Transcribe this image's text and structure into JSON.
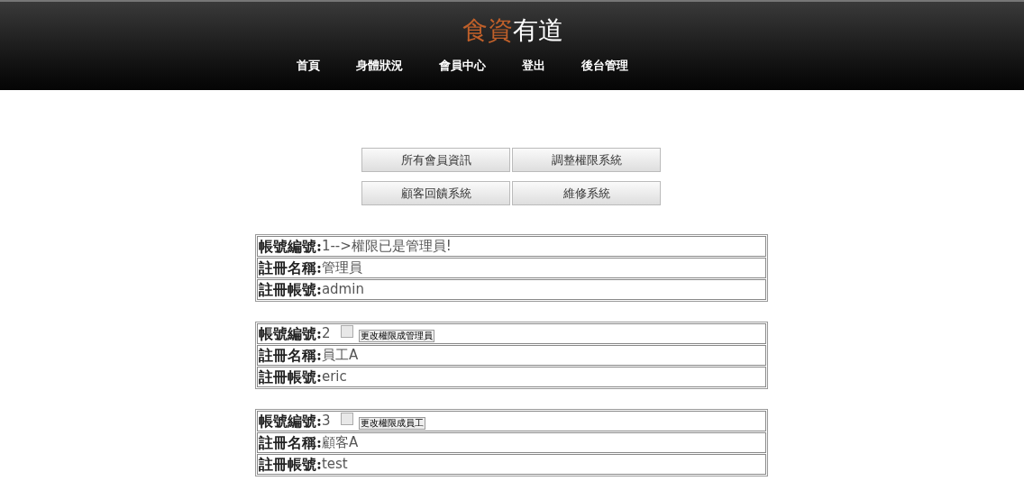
{
  "logo": [
    {
      "text": "食資",
      "color": "#c0602a"
    },
    {
      "text": "有道",
      "color": "#ffffff"
    }
  ],
  "nav": [
    "首頁",
    "身體狀況",
    "會員中心",
    "登出",
    "後台管理"
  ],
  "admin_buttons": [
    "所有會員資訊",
    "調整權限系統",
    "顧客回饋系統",
    "維修系統"
  ],
  "members": [
    {
      "rows": [
        {
          "label": "帳號編號:",
          "value": "1-->權限已是管理員!"
        },
        {
          "label": "註冊名稱:",
          "value": "管理員"
        },
        {
          "label": "註冊帳號:",
          "value": "admin"
        }
      ]
    },
    {
      "rows": [
        {
          "label": "帳號編號:",
          "value": "2"
        },
        {
          "label": "註冊名稱:",
          "value": "員工A"
        },
        {
          "label": "註冊帳號:",
          "value": "eric"
        }
      ],
      "checkbox": {
        "checked": false
      },
      "action": "更改權限成管理員"
    },
    {
      "rows": [
        {
          "label": "帳號編號:",
          "value": "3"
        },
        {
          "label": "註冊名稱:",
          "value": "顧客A"
        },
        {
          "label": "註冊帳號:",
          "value": "test"
        }
      ],
      "checkbox": {
        "checked": false
      },
      "action": "更改權限成員工"
    }
  ]
}
